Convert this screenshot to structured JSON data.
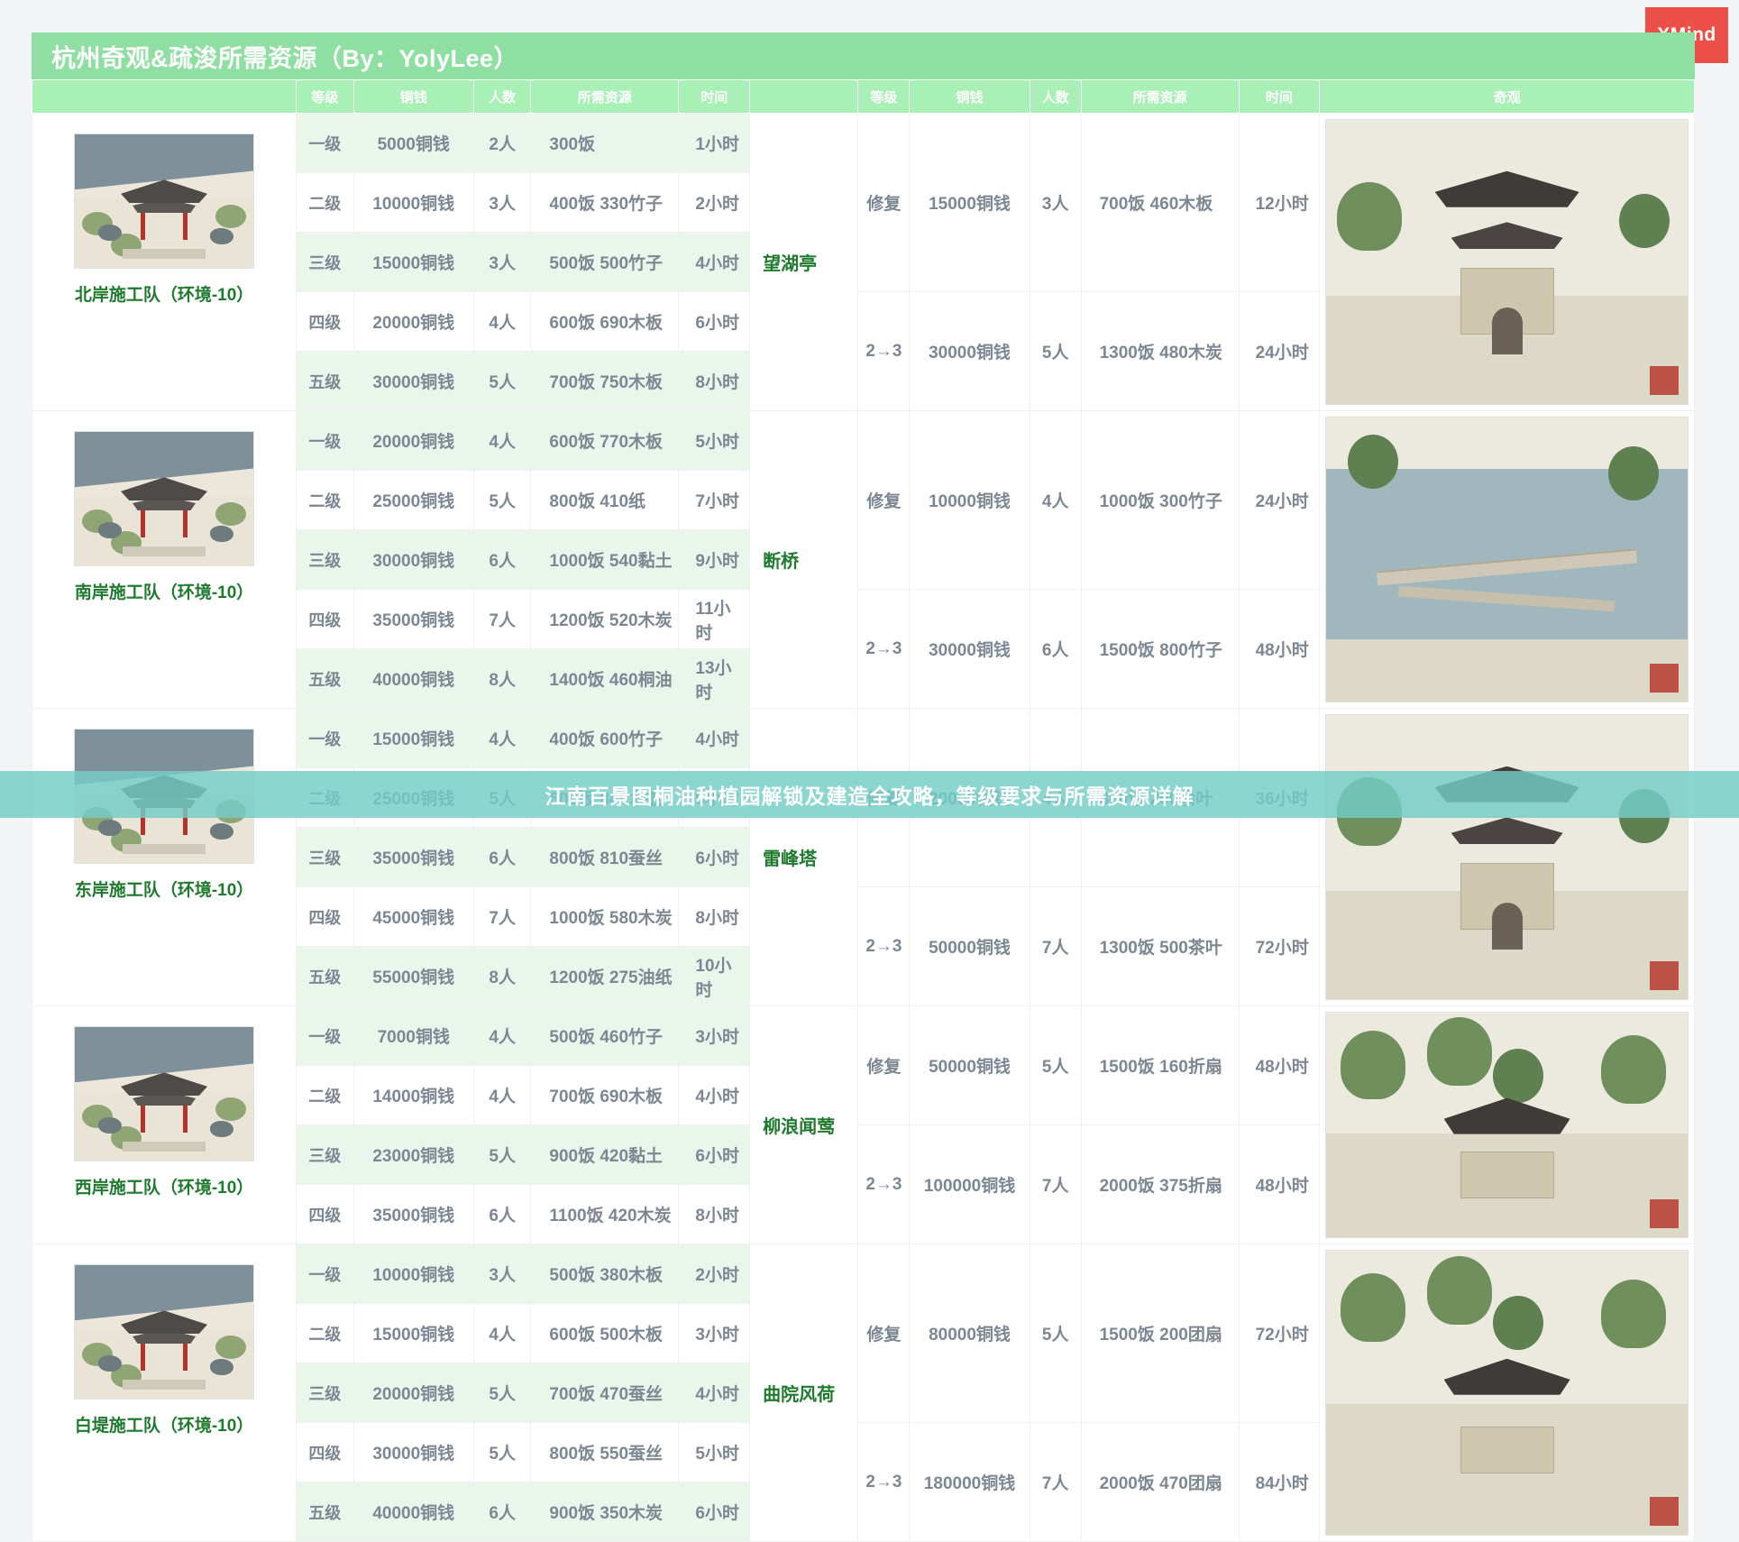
{
  "app": {
    "logo_text": "XMind"
  },
  "sheet": {
    "title": "杭州奇观&疏浚所需资源（By：YolyLee）"
  },
  "headers": {
    "team": "",
    "level": "等级",
    "coins": "铜钱",
    "people": "人数",
    "resources": "所需资源",
    "time": "时间",
    "wonder_blank": "",
    "w_level": "等级",
    "w_coins": "铜钱",
    "w_people": "人数",
    "w_resources": "所需资源",
    "w_time": "时间",
    "wonder": "奇观"
  },
  "banner": {
    "text": "江南百景图桐油种植园解锁及建造全攻略，等级要求与所需资源详解"
  },
  "blocks": [
    {
      "team": "北岸施工队（环境-10）",
      "rows": [
        {
          "level": "一级",
          "coins": "5000铜钱",
          "people": "2人",
          "resources": "300饭",
          "time": "1小时"
        },
        {
          "level": "二级",
          "coins": "10000铜钱",
          "people": "3人",
          "resources": "400饭 330竹子",
          "time": "2小时"
        },
        {
          "level": "三级",
          "coins": "15000铜钱",
          "people": "3人",
          "resources": "500饭 500竹子",
          "time": "4小时"
        },
        {
          "level": "四级",
          "coins": "20000铜钱",
          "people": "4人",
          "resources": "600饭 690木板",
          "time": "6小时"
        },
        {
          "level": "五级",
          "coins": "30000铜钱",
          "people": "5人",
          "resources": "700饭 750木板",
          "time": "8小时"
        }
      ],
      "wonder": "望湖亭",
      "wonder_rows": [
        {
          "stage": "修复",
          "coins": "15000铜钱",
          "people": "3人",
          "resources": "700饭 460木板",
          "time": "12小时"
        },
        {
          "stage": "2→3",
          "coins": "30000铜钱",
          "people": "5人",
          "resources": "1300饭 480木炭",
          "time": "24小时"
        }
      ]
    },
    {
      "team": "南岸施工队（环境-10）",
      "rows": [
        {
          "level": "一级",
          "coins": "20000铜钱",
          "people": "4人",
          "resources": "600饭 770木板",
          "time": "5小时"
        },
        {
          "level": "二级",
          "coins": "25000铜钱",
          "people": "5人",
          "resources": "800饭 410纸",
          "time": "7小时"
        },
        {
          "level": "三级",
          "coins": "30000铜钱",
          "people": "6人",
          "resources": "1000饭 540黏土",
          "time": "9小时"
        },
        {
          "level": "四级",
          "coins": "35000铜钱",
          "people": "7人",
          "resources": "1200饭 520木炭",
          "time": "11小时"
        },
        {
          "level": "五级",
          "coins": "40000铜钱",
          "people": "8人",
          "resources": "1400饭 460桐油",
          "time": "13小时"
        }
      ],
      "wonder": "断桥",
      "wonder_rows": [
        {
          "stage": "修复",
          "coins": "10000铜钱",
          "people": "4人",
          "resources": "1000饭 300竹子",
          "time": "24小时"
        },
        {
          "stage": "2→3",
          "coins": "30000铜钱",
          "people": "6人",
          "resources": "1500饭 800竹子",
          "time": "48小时"
        }
      ]
    },
    {
      "team": "东岸施工队（环境-10）",
      "rows": [
        {
          "level": "一级",
          "coins": "15000铜钱",
          "people": "4人",
          "resources": "400饭 600竹子",
          "time": "4小时"
        },
        {
          "level": "二级",
          "coins": "25000铜钱",
          "people": "5人",
          "resources": "600饭 846木板",
          "time": "5小时"
        },
        {
          "level": "三级",
          "coins": "35000铜钱",
          "people": "6人",
          "resources": "800饭 810蚕丝",
          "time": "6小时"
        },
        {
          "level": "四级",
          "coins": "45000铜钱",
          "people": "7人",
          "resources": "1000饭 580木炭",
          "time": "8小时"
        },
        {
          "level": "五级",
          "coins": "55000铜钱",
          "people": "8人",
          "resources": "1200饭 275油纸",
          "time": "10小时"
        }
      ],
      "wonder": "雷峰塔",
      "wonder_rows": [
        {
          "stage": "修复",
          "coins": "20000铜钱",
          "people": "4人",
          "resources": "800饭 200余叶",
          "time": "36小时"
        },
        {
          "stage": "2→3",
          "coins": "50000铜钱",
          "people": "7人",
          "resources": "1300饭 500茶叶",
          "time": "72小时"
        }
      ]
    },
    {
      "team": "西岸施工队（环境-10）",
      "rows": [
        {
          "level": "一级",
          "coins": "7000铜钱",
          "people": "4人",
          "resources": "500饭 460竹子",
          "time": "3小时"
        },
        {
          "level": "二级",
          "coins": "14000铜钱",
          "people": "4人",
          "resources": "700饭 690木板",
          "time": "4小时"
        },
        {
          "level": "三级",
          "coins": "23000铜钱",
          "people": "5人",
          "resources": "900饭 420黏土",
          "time": "6小时"
        },
        {
          "level": "四级",
          "coins": "35000铜钱",
          "people": "6人",
          "resources": "1100饭 420木炭",
          "time": "8小时"
        }
      ],
      "wonder": "柳浪闻莺",
      "wonder_rows": [
        {
          "stage": "修复",
          "coins": "50000铜钱",
          "people": "5人",
          "resources": "1500饭 160折扇",
          "time": "48小时"
        },
        {
          "stage": "2→3",
          "coins": "100000铜钱",
          "people": "7人",
          "resources": "2000饭 375折扇",
          "time": "48小时"
        }
      ]
    },
    {
      "team": "白堤施工队（环境-10）",
      "rows": [
        {
          "level": "一级",
          "coins": "10000铜钱",
          "people": "3人",
          "resources": "500饭 380木板",
          "time": "2小时"
        },
        {
          "level": "二级",
          "coins": "15000铜钱",
          "people": "4人",
          "resources": "600饭 500木板",
          "time": "3小时"
        },
        {
          "level": "三级",
          "coins": "20000铜钱",
          "people": "5人",
          "resources": "700饭 470蚕丝",
          "time": "4小时"
        },
        {
          "level": "四级",
          "coins": "30000铜钱",
          "people": "5人",
          "resources": "800饭 550蚕丝",
          "time": "5小时"
        },
        {
          "level": "五级",
          "coins": "40000铜钱",
          "people": "6人",
          "resources": "900饭 350木炭",
          "time": "6小时"
        }
      ],
      "wonder": "曲院风荷",
      "wonder_rows": [
        {
          "stage": "修复",
          "coins": "80000铜钱",
          "people": "5人",
          "resources": "1500饭 200团扇",
          "time": "72小时"
        },
        {
          "stage": "2→3",
          "coins": "180000铜钱",
          "people": "7人",
          "resources": "2000饭 470团扇",
          "time": "84小时"
        }
      ]
    }
  ],
  "colors": {
    "title_bg": "#8fdfa2",
    "header_bg": "#a9f0b6",
    "row_shade": "#eaf6ec",
    "text": "#7d8793",
    "wonder_text": "#1e7a2c",
    "banner_bg": "#73cdc8",
    "logo_bg": "#eb4f47"
  }
}
